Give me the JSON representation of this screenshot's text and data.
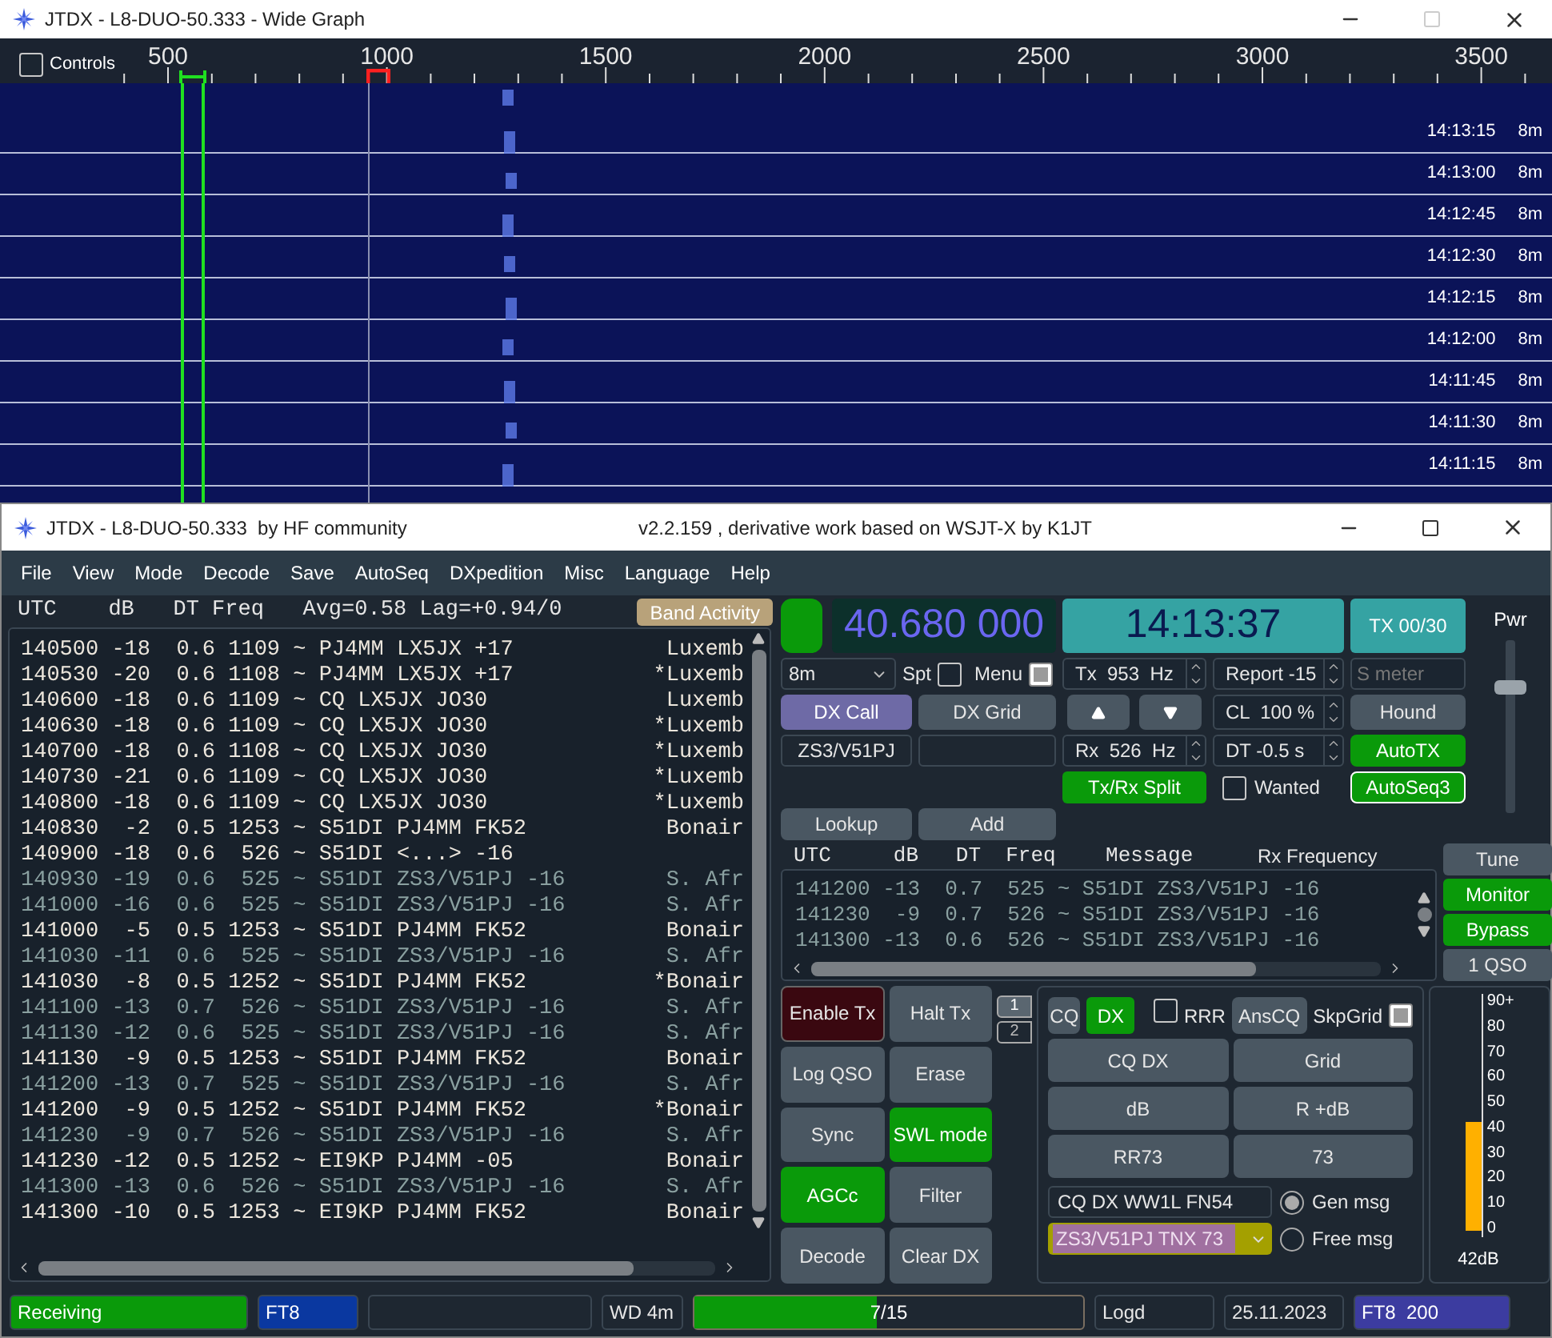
{
  "graph_window": {
    "title": "JTDX - L8-DUO-50.333 - Wide Graph",
    "controls": {
      "label": "Controls",
      "checked": false
    },
    "scale": [
      "500",
      "1000",
      "1500",
      "2000",
      "2500",
      "3000",
      "3500"
    ],
    "rows": [
      {
        "time": "14:13:15",
        "band": "8m"
      },
      {
        "time": "14:13:00",
        "band": "8m"
      },
      {
        "time": "14:12:45",
        "band": "8m"
      },
      {
        "time": "14:12:30",
        "band": "8m"
      },
      {
        "time": "14:12:15",
        "band": "8m"
      },
      {
        "time": "14:12:00",
        "band": "8m"
      },
      {
        "time": "14:11:45",
        "band": "8m"
      },
      {
        "time": "14:11:30",
        "band": "8m"
      },
      {
        "time": "14:11:15",
        "band": "8m"
      }
    ]
  },
  "main_window": {
    "title": "JTDX - L8-DUO-50.333  by HF community",
    "subtitle": "v2.2.159 , derivative work based on WSJT-X by K1JT"
  },
  "menu": [
    "File",
    "View",
    "Mode",
    "Decode",
    "Save",
    "AutoSeq",
    "DXpedition",
    "Misc",
    "Language",
    "Help"
  ],
  "band_activity": {
    "header": "UTC    dB   DT Freq   Avg=0.58 Lag=+0.94/0",
    "button": "Band Activity",
    "rows": [
      {
        "text": "140500 -18  0.6 1109 ~ PJ4MM LX5JX +17",
        "country": "Luxemb",
        "dimmed": false
      },
      {
        "text": "140530 -20  0.6 1108 ~ PJ4MM LX5JX +17",
        "country": "*Luxemb",
        "dimmed": false
      },
      {
        "text": "140600 -18  0.6 1109 ~ CQ LX5JX JO30",
        "country": "Luxemb",
        "dimmed": false
      },
      {
        "text": "140630 -18  0.6 1109 ~ CQ LX5JX JO30",
        "country": "*Luxemb",
        "dimmed": false
      },
      {
        "text": "140700 -18  0.6 1108 ~ CQ LX5JX JO30",
        "country": "*Luxemb",
        "dimmed": false
      },
      {
        "text": "140730 -21  0.6 1109 ~ CQ LX5JX JO30",
        "country": "*Luxemb",
        "dimmed": false
      },
      {
        "text": "140800 -18  0.6 1109 ~ CQ LX5JX JO30",
        "country": "*Luxemb",
        "dimmed": false
      },
      {
        "text": "140830  -2  0.5 1253 ~ S51DI PJ4MM FK52",
        "country": "Bonair",
        "dimmed": false
      },
      {
        "text": "140900 -18  0.6  526 ~ S51DI <...> -16",
        "dimmed": false
      },
      {
        "text": "140930 -19  0.6  525 ~ S51DI ZS3/V51PJ -16",
        "country": "S. Afr",
        "dimmed": true
      },
      {
        "text": "141000 -16  0.6  525 ~ S51DI ZS3/V51PJ -16",
        "country": "S. Afr",
        "dimmed": true
      },
      {
        "text": "141000  -5  0.5 1253 ~ S51DI PJ4MM FK52",
        "country": "Bonair",
        "dimmed": false
      },
      {
        "text": "141030 -11  0.6  525 ~ S51DI ZS3/V51PJ -16",
        "country": "S. Afr",
        "dimmed": true
      },
      {
        "text": "141030  -8  0.5 1252 ~ S51DI PJ4MM FK52",
        "country": "*Bonair",
        "dimmed": false
      },
      {
        "text": "141100 -13  0.7  526 ~ S51DI ZS3/V51PJ -16",
        "country": "S. Afr",
        "dimmed": true
      },
      {
        "text": "141130 -12  0.6  525 ~ S51DI ZS3/V51PJ -16",
        "country": "S. Afr",
        "dimmed": true
      },
      {
        "text": "141130  -9  0.5 1253 ~ S51DI PJ4MM FK52",
        "country": "Bonair",
        "dimmed": false
      },
      {
        "text": "141200 -13  0.7  525 ~ S51DI ZS3/V51PJ -16",
        "country": "S. Afr",
        "dimmed": true
      },
      {
        "text": "141200  -9  0.5 1252 ~ S51DI PJ4MM FK52",
        "country": "*Bonair",
        "dimmed": false
      },
      {
        "text": "141230  -9  0.7  526 ~ S51DI ZS3/V51PJ -16",
        "country": "S. Afr",
        "dimmed": true
      },
      {
        "text": "141230 -12  0.5 1252 ~ EI9KP PJ4MM -05",
        "country": "Bonair",
        "dimmed": false
      },
      {
        "text": "141300 -13  0.6  526 ~ S51DI ZS3/V51PJ -16",
        "country": "S. Afr",
        "dimmed": true
      },
      {
        "text": "141300 -10  0.5 1253 ~ EI9KP PJ4MM FK52",
        "country": "Bonair",
        "dimmed": false
      }
    ]
  },
  "radio": {
    "indicator_on": true,
    "frequency": "40.680 000",
    "clock": "14:13:37",
    "tx_counter": "TX 00/30",
    "band": "8m",
    "spot": {
      "label": "Spt",
      "checked": false
    },
    "menu_toggle": {
      "label": "Menu",
      "checked": true
    },
    "tx_freq": "Tx  953  Hz",
    "report": "Report -15",
    "s_meter": {
      "placeholder": "S meter"
    },
    "dx_call_button": "DX Call",
    "dx_grid_button": "DX Grid",
    "cl": "CL  100 %",
    "hound": {
      "label": "Hound",
      "on": false
    },
    "dx_call": "ZS3/V51PJ",
    "rx_freq": "Rx  526  Hz",
    "dt": "DT -0.5 s",
    "autotx": {
      "label": "AutoTX",
      "on": true
    },
    "split": {
      "label": "Tx/Rx Split",
      "on": true
    },
    "wanted": {
      "label": "Wanted",
      "checked": false
    },
    "autoseq": {
      "label": "AutoSeq3",
      "on": true
    },
    "lookup": "Lookup",
    "add": "Add",
    "power": {
      "label": "Pwr",
      "level": 0.72
    }
  },
  "rx_frequency": {
    "header": "UTC     dB   DT  Freq    Message",
    "title": "Rx Frequency",
    "rows": [
      "141200 -13  0.7  525 ~ S51DI ZS3/V51PJ -16",
      "141230  -9  0.7  526 ~ S51DI ZS3/V51PJ -16",
      "141300 -13  0.6  526 ~ S51DI ZS3/V51PJ -16"
    ]
  },
  "side_buttons": [
    {
      "label": "Tune",
      "on": false
    },
    {
      "label": "Monitor",
      "on": true
    },
    {
      "label": "Bypass",
      "on": true
    },
    {
      "label": "1 QSO",
      "on": false
    }
  ],
  "control_buttons": [
    {
      "label": "Enable Tx",
      "kind": "tx",
      "on": false
    },
    {
      "label": "Halt Tx",
      "kind": "toggle",
      "on": false
    },
    {
      "label": "Log QSO",
      "kind": "toggle",
      "on": false
    },
    {
      "label": "Erase",
      "kind": "toggle",
      "on": false
    },
    {
      "label": "Sync",
      "kind": "toggle",
      "on": false
    },
    {
      "label": "SWL mode",
      "kind": "toggle",
      "on": true
    },
    {
      "label": "AGCc",
      "kind": "toggle",
      "on": true
    },
    {
      "label": "Filter",
      "kind": "toggle",
      "on": false
    },
    {
      "label": "Decode",
      "kind": "toggle",
      "on": false
    },
    {
      "label": "Clear DX",
      "kind": "toggle",
      "on": false
    }
  ],
  "tabs": [
    {
      "label": "1",
      "selected": true
    },
    {
      "label": "2",
      "selected": false
    }
  ],
  "messages": {
    "cq": {
      "label": "CQ",
      "on": false
    },
    "dx": {
      "label": "DX",
      "on": true
    },
    "rrr": {
      "label": "RRR",
      "checked": false
    },
    "anscq": {
      "label": "AnsCQ",
      "on": false
    },
    "skpgrid": {
      "label": "SkpGrid",
      "checked": true
    },
    "buttons": [
      "CQ DX",
      "Grid",
      "dB",
      "R +dB",
      "RR73",
      "73"
    ],
    "free_text": "CQ DX WW1L FN54",
    "selected_message": "ZS3/V51PJ TNX 73",
    "radios": [
      {
        "label": "Gen msg",
        "selected": true
      },
      {
        "label": "Free msg",
        "selected": false
      }
    ]
  },
  "meter": {
    "scale": [
      "90+",
      "80",
      "70",
      "60",
      "50",
      "40",
      "30",
      "20",
      "10",
      "0"
    ],
    "level": 0.47,
    "reading": "42dB"
  },
  "status_bar": {
    "state": "Receiving",
    "mode": "FT8",
    "wd": "WD 4m",
    "progress": {
      "text": "7/15",
      "level": 0.47
    },
    "log": "Logd",
    "date": "25.11.2023",
    "mode_info": "FT8  200"
  }
}
